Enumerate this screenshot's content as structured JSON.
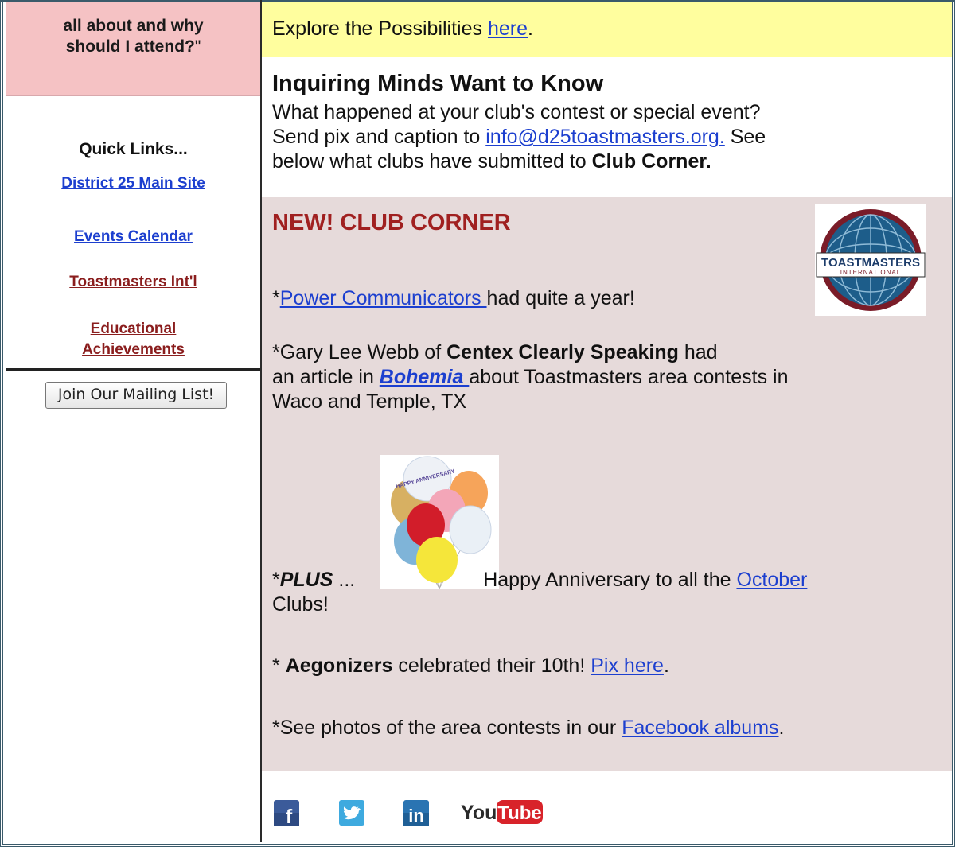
{
  "sidebar": {
    "promo_line1": "all about and why",
    "promo_line2": "should I attend?",
    "promo_quote": "\"",
    "quick_links_title": "Quick Links...",
    "links": [
      {
        "label": "District 25 Main Site"
      },
      {
        "label": "Events Calendar"
      },
      {
        "label": "Toastmasters Int'l"
      },
      {
        "label_line1": "Educational",
        "label_line2": "Achievements"
      }
    ],
    "join_button": "Join Our Mailing List!"
  },
  "main": {
    "explore": {
      "text": "Explore the Possibilities ",
      "link": "here",
      "suffix": "."
    },
    "inquiring": {
      "heading": "Inquiring Minds Want to Know",
      "line1": "What happened at your club's contest or special event?",
      "line2_pre": "Send pix and caption to ",
      "email": "info@d25toastmasters.org.",
      "line2_post": " See",
      "line3_pre": "below what clubs have submitted to ",
      "line3_bold": "Club Corner."
    },
    "club_corner": {
      "heading": "NEW! CLUB CORNER",
      "logo_text": "TOASTMASTERS",
      "logo_subtext": "INTERNATIONAL",
      "item1": {
        "prefix": "*",
        "link": "Power Communicators ",
        "rest": "had quite a year!"
      },
      "item2": {
        "prefix": "*Gary Lee Webb of ",
        "bold": "Centex Clearly Speaking",
        "rest1": " had",
        "line2_pre": "an article in ",
        "link": "Bohemia ",
        "line2_post": "about Toastmasters area contests in",
        "line3": "Waco and Temple, TX"
      },
      "item3": {
        "prefix": "*",
        "bold": "PLUS",
        "dots": " ...",
        "text": "Happy Anniversary to all the ",
        "link": "October",
        "line2": "Clubs!",
        "balloon_text": "HAPPY ANNIVERSARY"
      },
      "item4": {
        "prefix": "* ",
        "bold": "Aegonizers",
        "text": " celebrated their 10th! ",
        "link": "Pix here",
        "suffix": "."
      },
      "item5": {
        "text": "*See photos of the area contests in our ",
        "link": "Facebook albums",
        "suffix": "."
      }
    },
    "social": {
      "facebook": "f",
      "youtube_you": "You",
      "youtube_tube": "Tube",
      "linkedin": "in"
    }
  },
  "colors": {
    "link_blue": "#1c3fcf",
    "maroon": "#8a1d1d",
    "heading_red": "#a02020",
    "sidebar_pink": "#f5c2c4",
    "explore_yellow": "#fffe9e",
    "corner_bg": "#e6dada"
  },
  "icons": [
    "facebook-icon",
    "twitter-icon",
    "linkedin-icon",
    "youtube-icon",
    "toastmasters-logo",
    "balloons-image"
  ]
}
